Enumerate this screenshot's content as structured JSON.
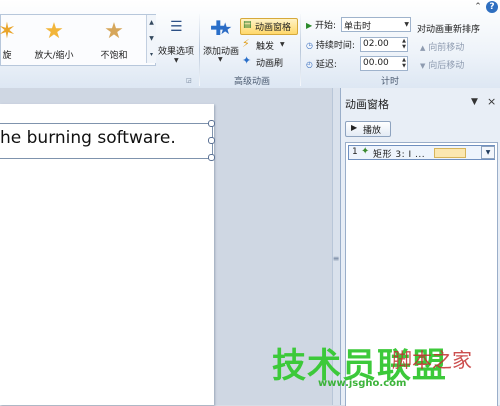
{
  "ribbon": {
    "gallery": {
      "items": [
        {
          "label": "旋",
          "icon": "spin-star-icon"
        },
        {
          "label": "放大/缩小",
          "icon": "grow-shrink-star-icon"
        },
        {
          "label": "不饱和",
          "icon": "desaturate-star-icon"
        }
      ]
    },
    "effect_options": {
      "label": "效果选项"
    },
    "advanced_animation": {
      "add_animation_label": "添加动画",
      "animation_pane_label": "动画窗格",
      "trigger_label": "触发",
      "painter_label": "动画刷",
      "group_label": "高级动画"
    },
    "timing": {
      "start_label": "开始:",
      "start_value": "单击时",
      "duration_label": "持续时间:",
      "duration_value": "02.00",
      "delay_label": "延迟:",
      "delay_value": "00.00",
      "group_label": "计时"
    },
    "reorder": {
      "title": "对动画重新排序",
      "move_earlier": "向前移动",
      "move_later": "向后移动"
    }
  },
  "slide": {
    "text": "he burning software."
  },
  "animation_pane": {
    "title": "动画窗格",
    "play_label": "播放",
    "items": [
      {
        "number": "1",
        "name": "矩形 3: I ..."
      }
    ]
  },
  "watermark": {
    "main": "技术员联盟",
    "url": "www.jsgho.com",
    "side": "脚本之家"
  },
  "colors": {
    "ribbon_text": "#1e395b",
    "highlight": "#ffd86b",
    "watermark_green": "#3cc93a"
  }
}
